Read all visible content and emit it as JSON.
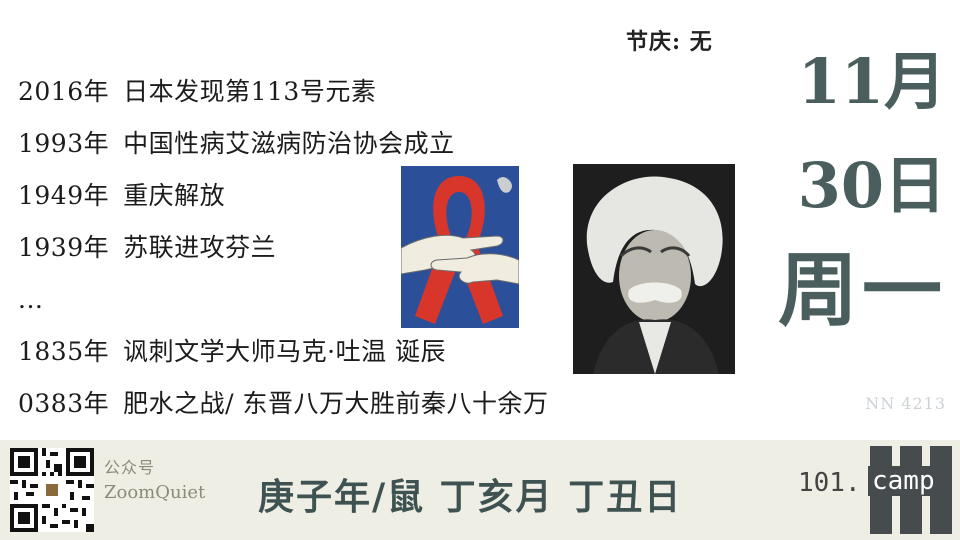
{
  "festival": {
    "label": "节庆:",
    "value": "无"
  },
  "events": [
    {
      "year": "2016年",
      "text": "日本发现第113号元素"
    },
    {
      "year": "1993年",
      "text": "中国性病艾滋病防治协会成立"
    },
    {
      "year": "1949年",
      "text": "重庆解放"
    },
    {
      "year": "1939年",
      "text": "苏联进攻芬兰"
    },
    {
      "year": "...",
      "text": ""
    },
    {
      "year": "1835年",
      "text": "讽刺文学大师马克·吐温 诞辰"
    },
    {
      "year": "0383年",
      "text": "肥水之战/ 东晋八万大胜前秦八十余万"
    }
  ],
  "date": {
    "month": "11月",
    "day": "30日",
    "weekday": "周一"
  },
  "code": "NN 4213",
  "footer": {
    "account_label": "公众号",
    "account_name": "ZoomQuiet",
    "ganzhi": "庚子年/鼠 丁亥月 丁丑日",
    "logo_prefix": "101.",
    "logo_word": "camp"
  },
  "colors": {
    "date_accent": "#4a5e5e",
    "footer_bg": "#efeee4",
    "ribbon": "#d8362a",
    "ribbon_bg": "#2c4f9a"
  }
}
